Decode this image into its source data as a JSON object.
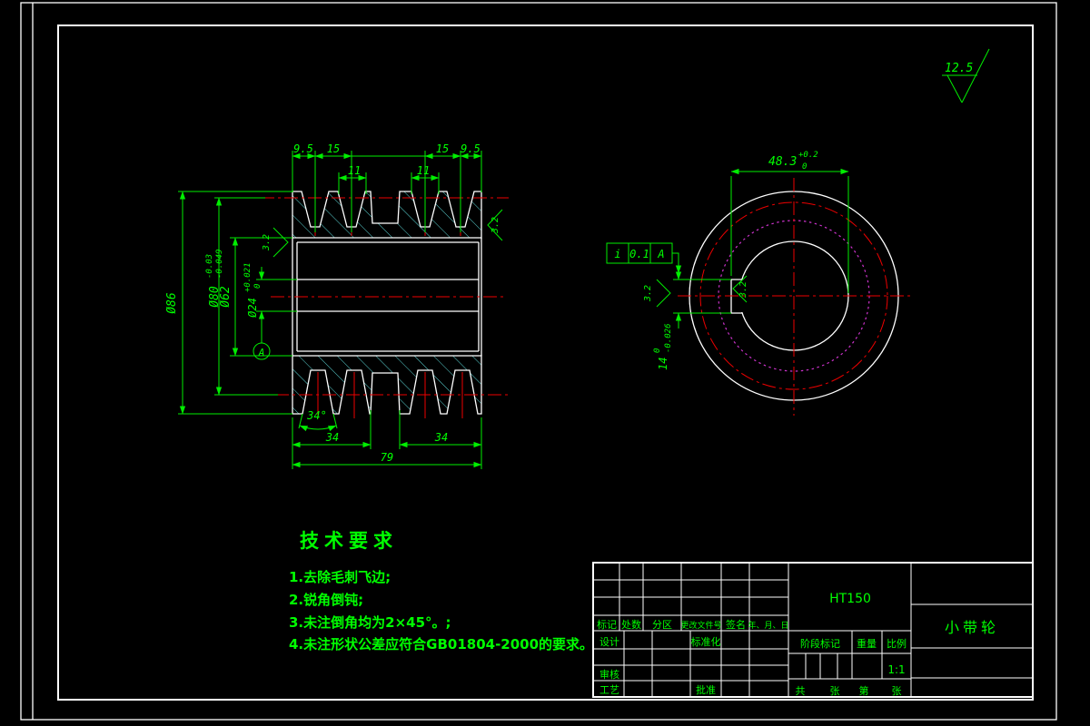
{
  "colors": {
    "background": "#000000",
    "outline": "#ffffff",
    "annotation": "#00ff00",
    "centerline": "#ff0000",
    "hatch": "#5ad2d2",
    "hidden_circle": "#cc33cc"
  },
  "global_roughness": "12.5",
  "front_view": {
    "top_dims": {
      "d1": "9.5",
      "d2": "15",
      "d3": "11",
      "d4": "11",
      "d5": "15",
      "d6": "9.5"
    },
    "dia86": "Ø86",
    "dia80": {
      "main": "Ø80",
      "up": "-0.03",
      "low": "-0.049"
    },
    "dia62": "Ø62",
    "dia24": {
      "main": "Ø24",
      "up": "+0.021",
      "low": "0"
    },
    "datum": "A",
    "angle": "34°",
    "bottom_dims": {
      "left": "34",
      "right": "34",
      "total": "79"
    },
    "roughness_left": "3.2",
    "roughness_right": "3.2"
  },
  "side_view": {
    "width_dim": {
      "main": "48.3",
      "up": "+0.2",
      "low": "0"
    },
    "key_dim": {
      "main": "14",
      "up": "0",
      "low": "-0.026"
    },
    "fcf": {
      "sym": "i",
      "tol": "0.1",
      "datum": "A"
    },
    "roughness_dim": "3.2",
    "roughness_keyway": "3.2"
  },
  "tech_req": {
    "title": "技术要求",
    "items": [
      "1.去除毛刺飞边;",
      "2.锐角倒钝;",
      "3.未注倒角均为2×45°。;",
      "4.未注形状公差应符合GB01804-2000的要求。"
    ]
  },
  "title_block": {
    "material": "HT150",
    "part_name": "小带轮",
    "scale_value": "1:1",
    "labels": {
      "biaoji": "标记",
      "chushu": "处数",
      "fenqu": "分区",
      "gengggai": "更改文件号",
      "qianming": "签名",
      "nianyueri": "年、月、日",
      "sheji": "设计",
      "biaozhunhua": "标准化",
      "shenhe": "审核",
      "gongyi": "工艺",
      "pizhun": "批准",
      "jieduanbiaoji": "阶段标记",
      "zhongliang": "重量",
      "bili": "比例",
      "gong": "共",
      "zhang1": "张",
      "di": "第",
      "zhang2": "张"
    }
  }
}
